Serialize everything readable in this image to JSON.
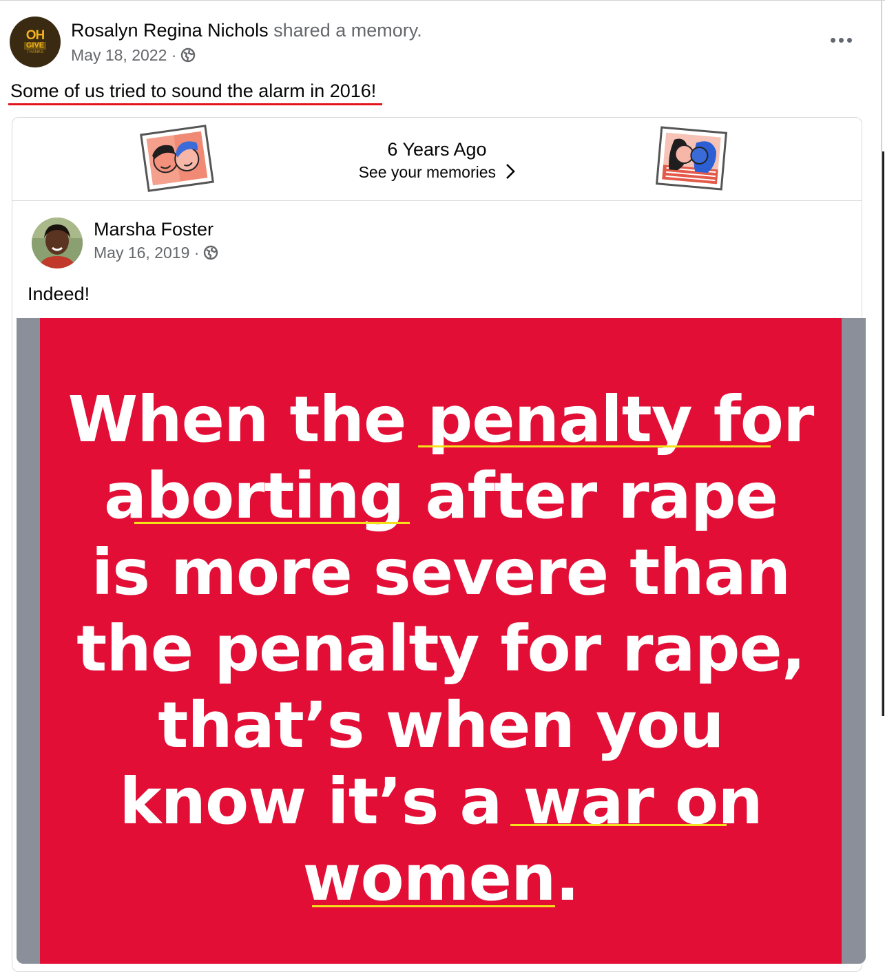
{
  "post": {
    "author": "Rosalyn Regina Nichols",
    "action": "shared a memory.",
    "date": "May 18, 2022 ·",
    "avatar": {
      "line1": "OH",
      "line2": "GIVE",
      "line3": "THANKS"
    },
    "text": "Some of us tried to sound the alarm in 2016!",
    "more_icon": "more-horizontal-icon",
    "privacy_icon": "globe-icon"
  },
  "memory": {
    "title": "6 Years Ago",
    "link": "See your memories",
    "link_icon": "chevron-right-icon"
  },
  "shared_post": {
    "author": "Marsha Foster",
    "date": "May 16, 2019 ·",
    "text": "Indeed!"
  },
  "meme": {
    "lines": [
      "When the penalty for",
      "aborting after rape",
      "is more severe than",
      "the penalty for rape,",
      "that’s when you",
      "know it’s a war on",
      "women."
    ],
    "background_color": "#e20e36",
    "text_color": "#ffffff",
    "highlight_color": "#f4e21a"
  },
  "colors": {
    "annotation_red": "#e4131b",
    "secondary_text": "#65676b"
  }
}
